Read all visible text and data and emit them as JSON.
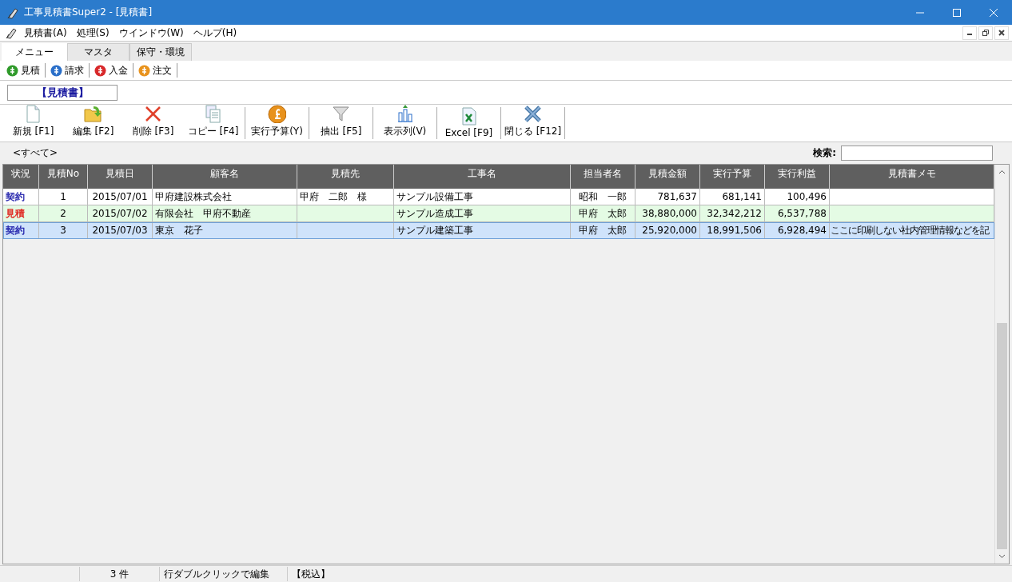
{
  "window": {
    "title": "工事見積書Super2 - [見積書]"
  },
  "menu": [
    "見積書(A)",
    "処理(S)",
    "ウインドウ(W)",
    "ヘルプ(H)"
  ],
  "tabs": [
    {
      "label": "メニュー",
      "selected": true
    },
    {
      "label": "マスタ",
      "selected": false
    },
    {
      "label": "保守・環境",
      "selected": false
    }
  ],
  "quick_links": [
    {
      "label": "見積",
      "color": "#2f9a2a"
    },
    {
      "label": "請求",
      "color": "#2a6fc9"
    },
    {
      "label": "入金",
      "color": "#d8282a"
    },
    {
      "label": "注文",
      "color": "#e8921c"
    }
  ],
  "section_title": "【見積書】",
  "toolbar": [
    {
      "label": "新規 [F1]",
      "kind": "new"
    },
    {
      "label": "編集 [F2]",
      "kind": "edit"
    },
    {
      "label": "削除 [F3]",
      "kind": "delete"
    },
    {
      "label": "コピー [F4]",
      "kind": "copy"
    },
    {
      "label": "実行予算(Y)",
      "kind": "budget"
    },
    {
      "label": "抽出 [F5]",
      "kind": "filter"
    },
    {
      "label": "表示列(V)",
      "kind": "columns"
    },
    {
      "label": "Excel [F9]",
      "kind": "excel"
    },
    {
      "label": "閉じる [F12]",
      "kind": "close"
    }
  ],
  "filter_label": "<すべて>",
  "search": {
    "label": "検索:"
  },
  "table": {
    "columns": [
      "状況",
      "見積No",
      "見積日",
      "顧客名",
      "見積先",
      "工事名",
      "担当者名",
      "見積金額",
      "実行予算",
      "実行利益",
      "見積書メモ"
    ],
    "rows": [
      {
        "selected": false,
        "color": "#1a1aa8",
        "cells": [
          "契約",
          "1",
          "2015/07/01",
          "甲府建設株式会社",
          "甲府　二郎　様",
          "サンプル設備工事",
          "昭和　一郎",
          "781,637",
          "681,141",
          "100,496"
        ]
      },
      {
        "selected": false,
        "color": "#e0201a",
        "cells": [
          "見積",
          "2",
          "2015/07/02",
          "有限会社　甲府不動産",
          "",
          "サンプル造成工事",
          "甲府　太郎",
          "38,880,000",
          "32,342,212",
          "6,537,788"
        ]
      },
      {
        "selected": true,
        "color": "#1a1aa8",
        "cells": [
          "契約",
          "3",
          "2015/07/03",
          "東京　花子",
          "",
          "サンプル建築工事",
          "甲府　太郎",
          "25,920,000",
          "18,991,506",
          "6,928,494",
          "ここに印刷しない社内管理情報などを記"
        ]
      }
    ]
  },
  "status_bar": [
    "3 件",
    "行ダブルクリックで編集",
    "【税込】"
  ]
}
